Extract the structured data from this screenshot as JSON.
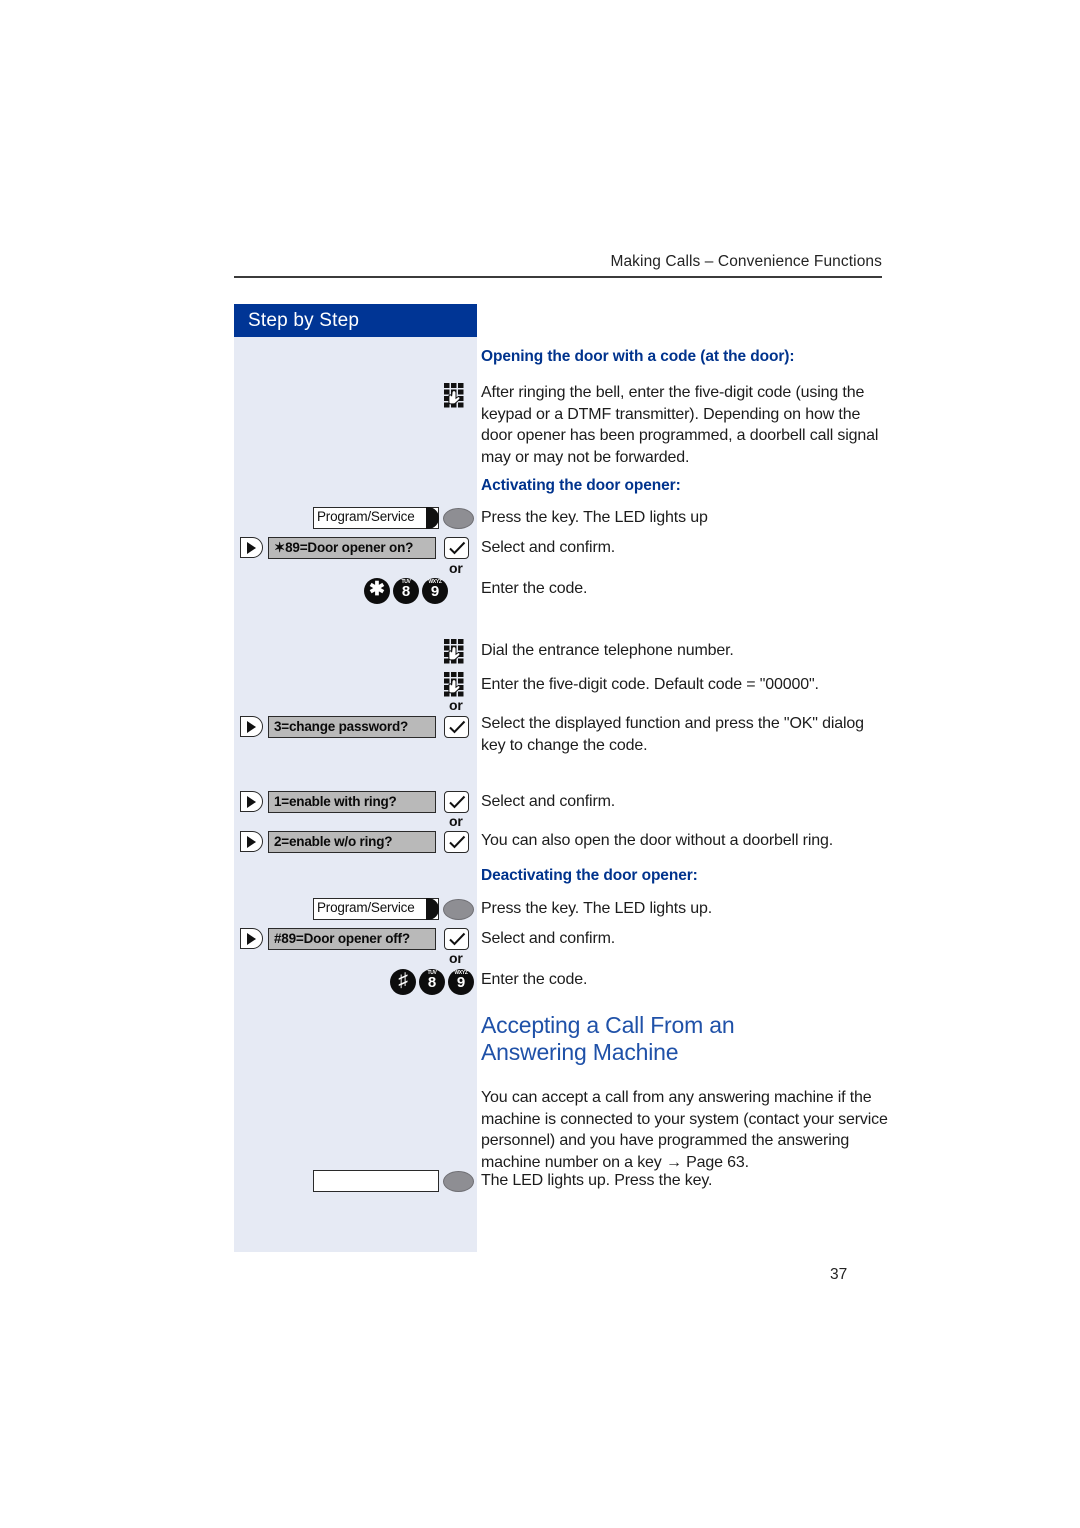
{
  "document": {
    "running_header": "Making Calls – Convenience Functions",
    "page_number": "37"
  },
  "sidebar": {
    "title": "Step by Step"
  },
  "colors": {
    "sidebar_background": "#e6eaf4",
    "sidebar_title_background": "#003595",
    "heading_blue": "#00338d",
    "section_title_blue": "#1f51a8",
    "display_box_gray": "#b9b9b9",
    "led_gray": "#8e8e93"
  },
  "content": {
    "heading_opening_door": "Opening the door with a code (at the door):",
    "para_after_ringing": "After ringing the bell, enter the five-digit code (using the keypad or a DTMF transmitter). Depending on how the door opener has been programmed, a doorbell call signal may or may not be forwarded.",
    "heading_activating": "Activating the door opener:",
    "text_press_key_led_up": "Press the key. The LED lights up",
    "text_select_confirm_1": "Select and confirm.",
    "text_enter_code_1": "Enter the code.",
    "text_dial_entrance": "Dial the entrance telephone number.",
    "text_enter_five_digit_default": "Enter the five-digit code. Default code = \"00000\".",
    "text_select_displayed_function": "Select the displayed function and press the \"OK\" dialog key to change the code.",
    "text_select_confirm_2": "Select and confirm.",
    "text_open_without_ring": "You can also open the door without a doorbell ring.",
    "heading_deactivating": "Deactivating the door opener:",
    "text_press_key_led_up_2": "Press the key. The LED lights up.",
    "text_select_confirm_3": "Select and confirm.",
    "text_enter_code_2": "Enter the code.",
    "section_title_answering": "Accepting a Call From an Answering Machine",
    "para_answering": "You can accept a call from any answering machine if the machine is connected to your system (contact your service personnel) and you have programmed the answering machine number on a key → Page 63.",
    "text_led_lights_press": "The LED lights up. Press the key."
  },
  "keys": {
    "program_service_1": "Program/Service",
    "program_service_2": "Program/Service",
    "blank_key": "",
    "or_1": "or",
    "or_2": "or",
    "or_3": "or",
    "or_4": "or"
  },
  "display_rows": [
    {
      "text": "✶89=Door opener on?"
    },
    {
      "text": "3=change password?"
    },
    {
      "text": "1=enable with ring?"
    },
    {
      "text": "2=enable w/o ring?"
    },
    {
      "text": "#89=Door opener off?"
    }
  ],
  "digit_keys": {
    "code_on": [
      {
        "main": "✱",
        "sub": "",
        "symbol": true
      },
      {
        "main": "8",
        "sub": "TUV",
        "symbol": false
      },
      {
        "main": "9",
        "sub": "WXYZ",
        "symbol": false
      }
    ],
    "code_off": [
      {
        "main": "♯",
        "sub": "",
        "symbol": true
      },
      {
        "main": "8",
        "sub": "TUV",
        "symbol": false
      },
      {
        "main": "9",
        "sub": "WXYZ",
        "symbol": false
      }
    ]
  }
}
